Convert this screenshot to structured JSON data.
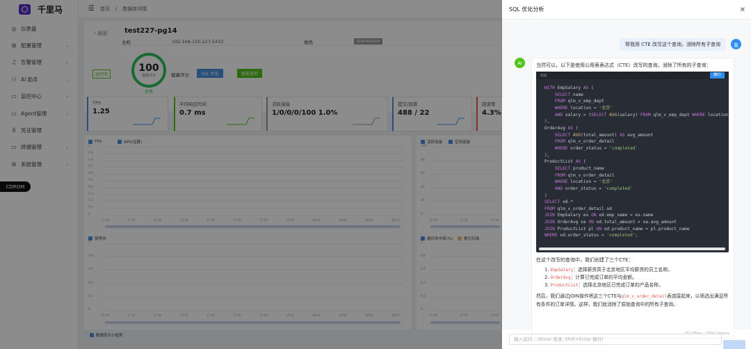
{
  "app": {
    "name": "千里马"
  },
  "sidebar": {
    "items": [
      {
        "label": "仪表盘",
        "icon": "dashboard-icon",
        "glyph": "◎",
        "arrow": ""
      },
      {
        "label": "配置管理",
        "icon": "grid-icon",
        "glyph": "⊞",
        "arrow": "⌄"
      },
      {
        "label": "告警管理",
        "icon": "bell-icon",
        "glyph": "♫",
        "arrow": "⌄"
      },
      {
        "label": "AI 助手",
        "icon": "robot-icon",
        "glyph": "⚇",
        "arrow": "⌄"
      },
      {
        "label": "监控中心",
        "icon": "monitor-icon",
        "glyph": "▭",
        "arrow": "⌄"
      },
      {
        "label": "Agent管理",
        "icon": "agent-icon",
        "glyph": "▭",
        "arrow": "⌄"
      },
      {
        "label": "凭证管理",
        "icon": "key-icon",
        "glyph": "♁",
        "arrow": ""
      },
      {
        "label": "终端管理",
        "icon": "terminal-icon",
        "glyph": "▭",
        "arrow": "⌄"
      },
      {
        "label": "系统管理",
        "icon": "settings-icon",
        "glyph": "⚙",
        "arrow": "⌄"
      }
    ],
    "badge": "CDROM"
  },
  "topbar": {
    "crumb_home": "首页",
    "crumb_sep": "/",
    "crumb_current": "数据库详情"
  },
  "detail": {
    "back": "‹ 返回",
    "title": "test227-pg14",
    "host_label": "主机",
    "host_value": "192.168.150.227:5432",
    "role_label": "角色",
    "role_value": "standalone",
    "status": "运行中",
    "score": "100",
    "score_sub": "健康评分",
    "score_label": "优秀",
    "score_text": "健康评分",
    "btn_sql": "SQL 优化",
    "btn_smart": "智能巡检"
  },
  "metrics": [
    {
      "title": "TPS",
      "value": "1.25",
      "color": "#4a90e2"
    },
    {
      "title": "平均响应时间",
      "value": "0.7 ms",
      "color": "#52c41a"
    },
    {
      "title": "活跃连接",
      "value": "1/0/0/0/100 1.0%",
      "color": "#999999"
    },
    {
      "title": "提交/回滚",
      "value": "488 / 22",
      "color": "#4a90e2"
    },
    {
      "title": "回滚率",
      "value": "4.3%",
      "color": "#e45649"
    }
  ],
  "charts": {
    "top_left_legend": [
      "TPS",
      "RPS(估算)"
    ],
    "top_right_legend": [
      "活跃连接",
      "空闲连接"
    ],
    "mid_left_legend": [
      "锁等待"
    ],
    "mid_right_legend": [
      "缓存命中率(%)",
      "索引扫描"
    ],
    "y_ticks": [
      "1",
      "0.9",
      "0.8",
      "0.7",
      "0.6",
      "0.5",
      "0.4",
      "0.3",
      "0.2",
      "0.1",
      "0"
    ],
    "y_ticks_right": [
      "100",
      "80",
      "60",
      "40",
      "20",
      "0"
    ],
    "y_ticks_mid": [
      "1",
      "0.8",
      "0.6",
      "0.4",
      "0.2",
      "0"
    ],
    "x_ticks": [
      "17:20",
      "17:25",
      "17:30",
      "17:35",
      "17:40",
      "17:45",
      "17:50",
      "17:55",
      "18:00",
      "18:05",
      "18:10",
      "18:15"
    ],
    "x_ticks_right": [
      "17:20",
      "17:30",
      "17:40"
    ],
    "bottom_legend": "数据库大小趋势"
  },
  "drawer": {
    "title": "SQL 优化分析",
    "user_msg": "帮我用 CTE 改写这个查询，消除所有子查询",
    "user_avatar": "我",
    "ai_avatar": "AI",
    "ai_intro": "当然可以，以下是使用公用表表达式（CTE）改写的查询，消除了所有的子查询：",
    "code_lang": "SQL",
    "code_btn": "换行",
    "after_code": "在这个改写的查询中，我们创建了三个CTE：",
    "ctes": [
      {
        "num": "1.",
        "name": "EmpSalary",
        "desc": "：选择薪资高于北京地区平均薪资的员工名称。"
      },
      {
        "num": "2.",
        "name": "OrderAvg",
        "desc": "：计算已完成订单的平均金额。"
      },
      {
        "num": "3.",
        "name": "ProductList",
        "desc": "：选择北京地区已完成订单的产品名称。"
      }
    ],
    "final_a": "然后，我们通过JOIN操作将这三个CTE与",
    "final_code": "qlm_v_order_detail",
    "final_b": "表连接起来，以筛选出满足所有条件的订单详情。这样，我们就消除了原始查询中的所有子查询。",
    "token_meta": "15278ms · 1592 tokens",
    "input_placeholder": "输入追问... (Enter 发送, Shift+Enter 换行)"
  }
}
